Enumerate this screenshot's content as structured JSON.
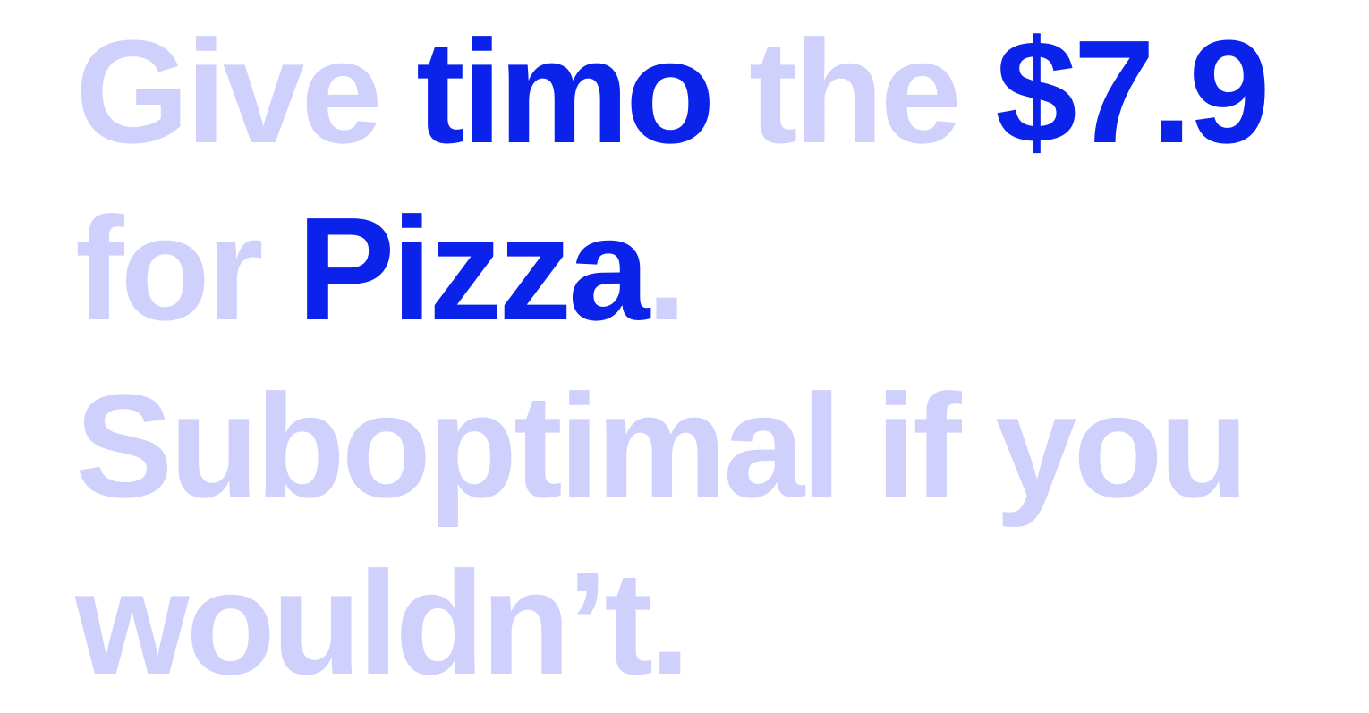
{
  "colors": {
    "muted": "#cfd0fb",
    "highlight": "#0a22ea",
    "background": "#ffffff"
  },
  "message": {
    "part1": "Give ",
    "recipient": "timo",
    "part2": " the ",
    "amount": "$7.9",
    "part3": " for ",
    "item": "Pizza",
    "part4": ". Suboptimal if you wouldn’t."
  }
}
